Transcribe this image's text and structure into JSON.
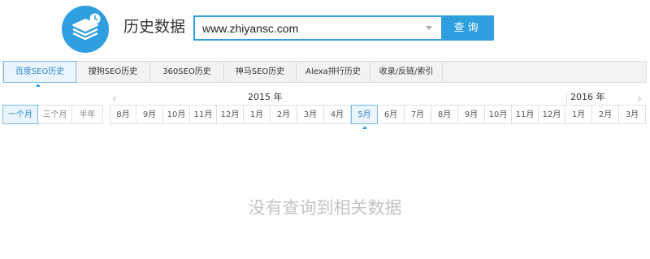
{
  "header": {
    "title": "历史数据",
    "logo_icon": "layers-clock-icon",
    "accent_color": "#2f9fe0"
  },
  "search": {
    "value": "www.zhiyansc.com",
    "button_label": "查询"
  },
  "tabs": [
    {
      "label": "百度SEO历史",
      "active": true
    },
    {
      "label": "搜狗SEO历史",
      "active": false
    },
    {
      "label": "360SEO历史",
      "active": false
    },
    {
      "label": "神马SEO历史",
      "active": false
    },
    {
      "label": "Alexa排行历史",
      "active": false
    },
    {
      "label": "收录/反链/索引",
      "active": false
    }
  ],
  "ranges": [
    {
      "label": "一个月",
      "active": true
    },
    {
      "label": "三个月",
      "active": false
    },
    {
      "label": "半年",
      "active": false
    }
  ],
  "timeline": {
    "year_2015": "2015 年",
    "year_2016": "2016 年",
    "prev_icon": "chevron-left-icon",
    "next_icon": "chevron-right-icon",
    "months": [
      "8月",
      "9月",
      "10月",
      "11月",
      "12月",
      "1月",
      "2月",
      "3月",
      "4月",
      "5月",
      "6月",
      "7月",
      "8月",
      "9月",
      "10月",
      "11月",
      "12月",
      "1月",
      "2月",
      "3月"
    ],
    "active_month_index": 9
  },
  "empty_message": "没有查询到相关数据"
}
